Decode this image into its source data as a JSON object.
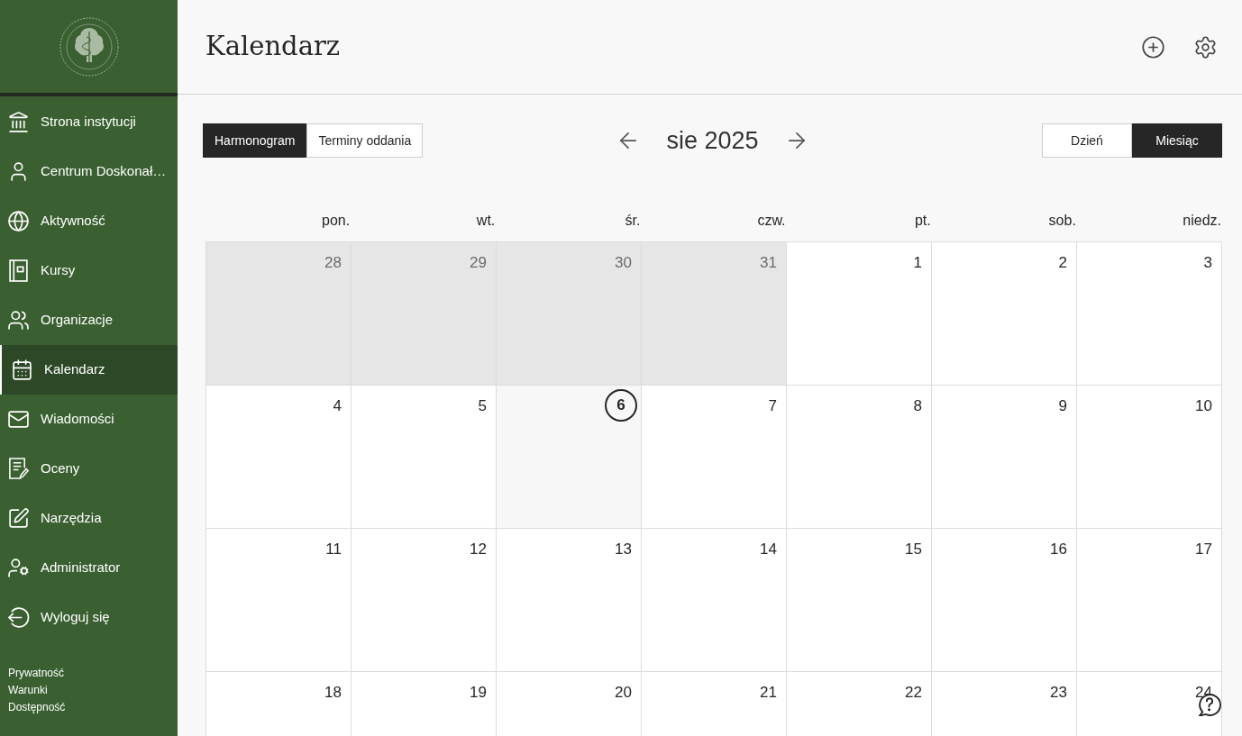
{
  "sidebar": {
    "items": [
      {
        "label": "Strona instytucji",
        "selected": false
      },
      {
        "label": "Centrum Doskonał…",
        "selected": false
      },
      {
        "label": "Aktywność",
        "selected": false
      },
      {
        "label": "Kursy",
        "selected": false
      },
      {
        "label": "Organizacje",
        "selected": false
      },
      {
        "label": "Kalendarz",
        "selected": true
      },
      {
        "label": "Wiadomości",
        "selected": false
      },
      {
        "label": "Oceny",
        "selected": false
      },
      {
        "label": "Narzędzia",
        "selected": false
      },
      {
        "label": "Administrator",
        "selected": false
      },
      {
        "label": "Wyloguj się",
        "selected": false
      }
    ],
    "footer_links": [
      "Prywatność",
      "Warunki",
      "Dostępność"
    ]
  },
  "header": {
    "title": "Kalendarz"
  },
  "toolbar": {
    "view_tabs": [
      {
        "label": "Harmonogram",
        "selected": true
      },
      {
        "label": "Terminy oddania",
        "selected": false
      }
    ],
    "period": "sie 2025",
    "range_tabs": [
      {
        "label": "Dzień",
        "selected": false
      },
      {
        "label": "Miesiąc",
        "selected": true
      }
    ]
  },
  "calendar": {
    "weekdays": [
      "pon.",
      "wt.",
      "śr.",
      "czw.",
      "pt.",
      "sob.",
      "niedz."
    ],
    "weeks": [
      [
        {
          "day": "28",
          "outside_month": true,
          "today": false
        },
        {
          "day": "29",
          "outside_month": true,
          "today": false
        },
        {
          "day": "30",
          "outside_month": true,
          "today": false
        },
        {
          "day": "31",
          "outside_month": true,
          "today": false
        },
        {
          "day": "1",
          "outside_month": false,
          "today": false
        },
        {
          "day": "2",
          "outside_month": false,
          "today": false
        },
        {
          "day": "3",
          "outside_month": false,
          "today": false
        }
      ],
      [
        {
          "day": "4",
          "outside_month": false,
          "today": false
        },
        {
          "day": "5",
          "outside_month": false,
          "today": false
        },
        {
          "day": "6",
          "outside_month": false,
          "today": true
        },
        {
          "day": "7",
          "outside_month": false,
          "today": false
        },
        {
          "day": "8",
          "outside_month": false,
          "today": false
        },
        {
          "day": "9",
          "outside_month": false,
          "today": false
        },
        {
          "day": "10",
          "outside_month": false,
          "today": false
        }
      ],
      [
        {
          "day": "11",
          "outside_month": false,
          "today": false
        },
        {
          "day": "12",
          "outside_month": false,
          "today": false
        },
        {
          "day": "13",
          "outside_month": false,
          "today": false
        },
        {
          "day": "14",
          "outside_month": false,
          "today": false
        },
        {
          "day": "15",
          "outside_month": false,
          "today": false
        },
        {
          "day": "16",
          "outside_month": false,
          "today": false
        },
        {
          "day": "17",
          "outside_month": false,
          "today": false
        }
      ],
      [
        {
          "day": "18",
          "outside_month": false,
          "today": false
        },
        {
          "day": "19",
          "outside_month": false,
          "today": false
        },
        {
          "day": "20",
          "outside_month": false,
          "today": false
        },
        {
          "day": "21",
          "outside_month": false,
          "today": false
        },
        {
          "day": "22",
          "outside_month": false,
          "today": false
        },
        {
          "day": "23",
          "outside_month": false,
          "today": false
        },
        {
          "day": "24",
          "outside_month": false,
          "today": false
        }
      ]
    ]
  }
}
